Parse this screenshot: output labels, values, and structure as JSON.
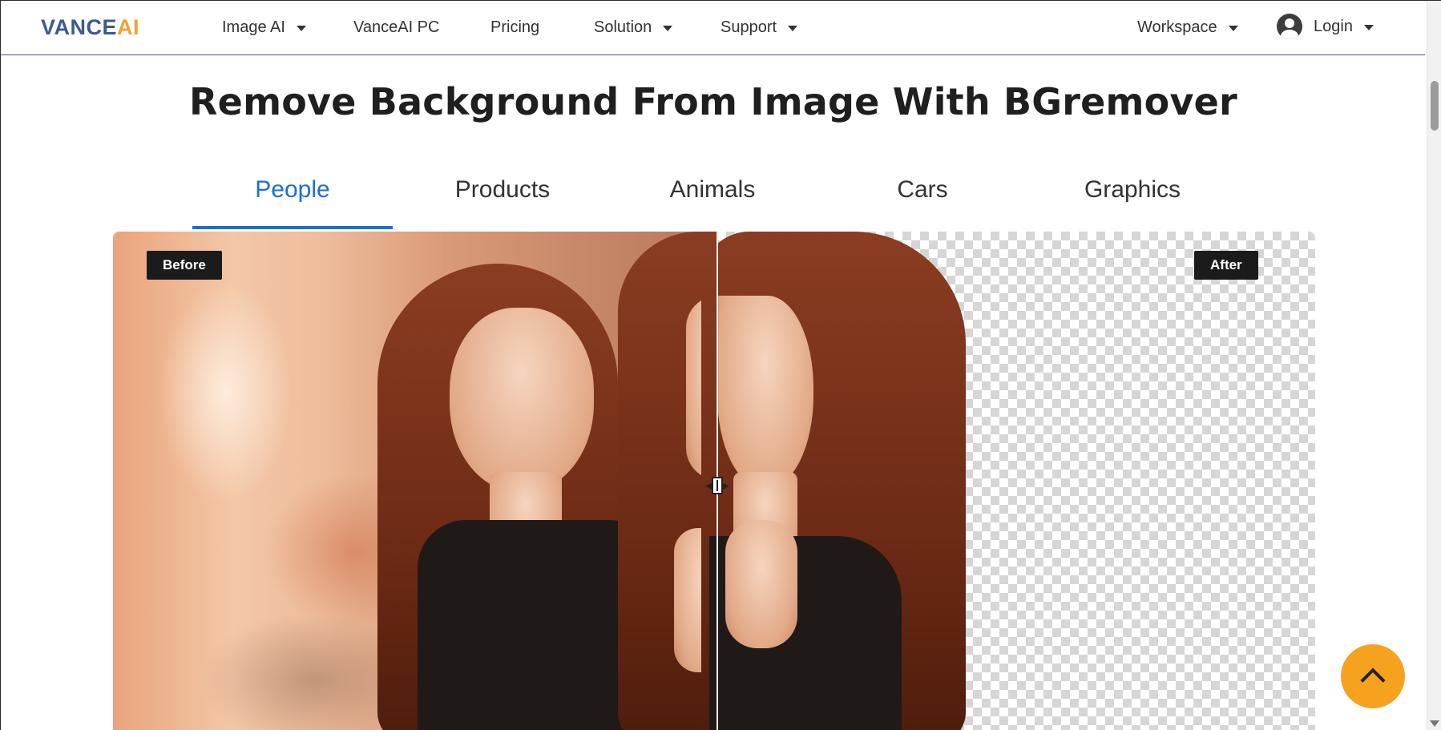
{
  "header": {
    "logo_main": "VANCE",
    "logo_accent": "AI",
    "nav": [
      {
        "label": "Image AI",
        "dropdown": true
      },
      {
        "label": "VanceAI PC",
        "dropdown": false
      },
      {
        "label": "Pricing",
        "dropdown": false
      },
      {
        "label": "Solution",
        "dropdown": true
      },
      {
        "label": "Support",
        "dropdown": true
      }
    ],
    "workspace_label": "Workspace",
    "login_label": "Login"
  },
  "main": {
    "title": "Remove Background From Image With BGremover",
    "tabs": [
      {
        "label": "People",
        "active": true
      },
      {
        "label": "Products",
        "active": false
      },
      {
        "label": "Animals",
        "active": false
      },
      {
        "label": "Cars",
        "active": false
      },
      {
        "label": "Graphics",
        "active": false
      }
    ],
    "compare": {
      "before_label": "Before",
      "after_label": "After"
    }
  },
  "colors": {
    "accent_blue": "#1a6fd3",
    "brand_navy": "#3b5b8c",
    "brand_orange": "#f2a22c",
    "back_to_top": "#f6a21e"
  },
  "icons": {
    "avatar": "user-circle-icon",
    "back_to_top": "chevron-up-icon",
    "slider_handle": "drag-handle-icon"
  }
}
